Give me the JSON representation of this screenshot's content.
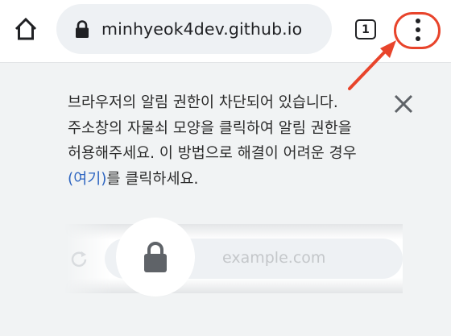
{
  "toolbar": {
    "home_icon": "home-icon",
    "lock_icon": "lock-icon",
    "url": "minhyeok4dev.github.io",
    "tab_count": "1",
    "menu_icon": "more-vert-icon"
  },
  "annotation": {
    "highlight_color": "#e8442b"
  },
  "notice": {
    "text_before_link": "브라우저의 알림 권한이 차단되어 있습니다. 주소창의 자물쇠 모양을 클릭하여 알림 권한을 허용해주세요. 이 방법으로 해결이 어려운 경우 ",
    "link_text": "(여기)",
    "text_after_link": "를 클릭하세요.",
    "link_color": "#2f66c1",
    "close_icon": "close-icon"
  },
  "illustration": {
    "reload_icon": "reload-icon",
    "lock_icon": "lock-icon",
    "url_example": "example.com"
  }
}
